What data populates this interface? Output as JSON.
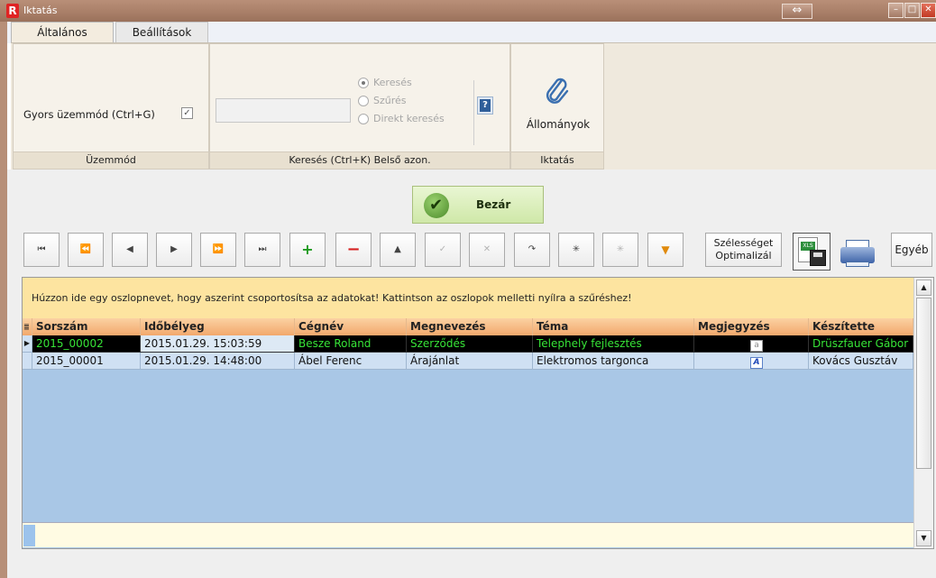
{
  "window": {
    "title": "Iktatás",
    "app_icon": "R",
    "resize_glyph": "⇔",
    "min_glyph": "–",
    "max_glyph": "□",
    "close_glyph": "✕"
  },
  "ribbon": {
    "tabs": [
      {
        "label": "Általános"
      },
      {
        "label": "Beállítások"
      }
    ],
    "mode_group": {
      "label": "Gyors üzemmód (Ctrl+G)",
      "checkbox_glyph": "✓",
      "footer": "Üzemmód"
    },
    "search_group": {
      "input_value": "",
      "options": [
        {
          "label": "Keresés",
          "selected": true
        },
        {
          "label": "Szűrés",
          "selected": false
        },
        {
          "label": "Direkt keresés",
          "selected": false
        }
      ],
      "help_glyph": "?",
      "footer": "Keresés (Ctrl+K) Belső azon."
    },
    "file_group": {
      "button_label": "Állományok",
      "footer": "Iktatás",
      "icon": "paperclip-icon"
    }
  },
  "toolbar": {
    "close_label": "Bezár",
    "nav_buttons": [
      {
        "name": "first-record-button",
        "glyph": "⏮"
      },
      {
        "name": "prev-page-button",
        "glyph": "⏪"
      },
      {
        "name": "prev-record-button",
        "glyph": "◀"
      },
      {
        "name": "next-record-button",
        "glyph": "▶"
      },
      {
        "name": "next-page-button",
        "glyph": "⏩"
      },
      {
        "name": "last-record-button",
        "glyph": "⏭"
      },
      {
        "name": "add-record-button",
        "glyph": "+"
      },
      {
        "name": "delete-record-button",
        "glyph": "−"
      },
      {
        "name": "edit-record-button",
        "glyph": "▲"
      },
      {
        "name": "post-edit-button",
        "glyph": "✓"
      },
      {
        "name": "cancel-edit-button",
        "glyph": "✕"
      },
      {
        "name": "refresh-button",
        "glyph": "↷"
      },
      {
        "name": "asterisk-button",
        "glyph": "✳"
      },
      {
        "name": "clear-asterisk-button",
        "glyph": "✳"
      },
      {
        "name": "filter-button",
        "glyph": "▼"
      }
    ],
    "width_button": {
      "line1": "Szélességet",
      "line2": "Optimalizál"
    },
    "xls_tag": "XLS",
    "other_button": "Egyéb"
  },
  "grid": {
    "group_hint": "Húzzon ide egy oszlopnevet, hogy aszerint csoportosítsa az adatokat! Kattintson az oszlopok melletti nyílra a szűréshez!",
    "columns": [
      {
        "label": "Sorszám"
      },
      {
        "label": "Időbélyeg"
      },
      {
        "label": "Cégnév"
      },
      {
        "label": "Megnevezés"
      },
      {
        "label": "Téma"
      },
      {
        "label": "Megjegyzés"
      },
      {
        "label": "Készítette"
      }
    ],
    "rows": [
      {
        "selected": true,
        "cells": [
          "2015_00002",
          "2015.01.29. 15:03:59",
          "Besze Roland",
          "Szerződés",
          "Telephely fejlesztés",
          "a",
          "Drüszfauer Gábor"
        ]
      },
      {
        "selected": false,
        "cells": [
          "2015_00001",
          "2015.01.29. 14:48:00",
          "Ábel Ferenc",
          "Árajánlat",
          "Elektromos targonca",
          "A",
          "Kovács Gusztáv"
        ]
      }
    ],
    "scroll_up_glyph": "▲",
    "scroll_down_glyph": "▼",
    "row_marker_glyph": "▶"
  }
}
